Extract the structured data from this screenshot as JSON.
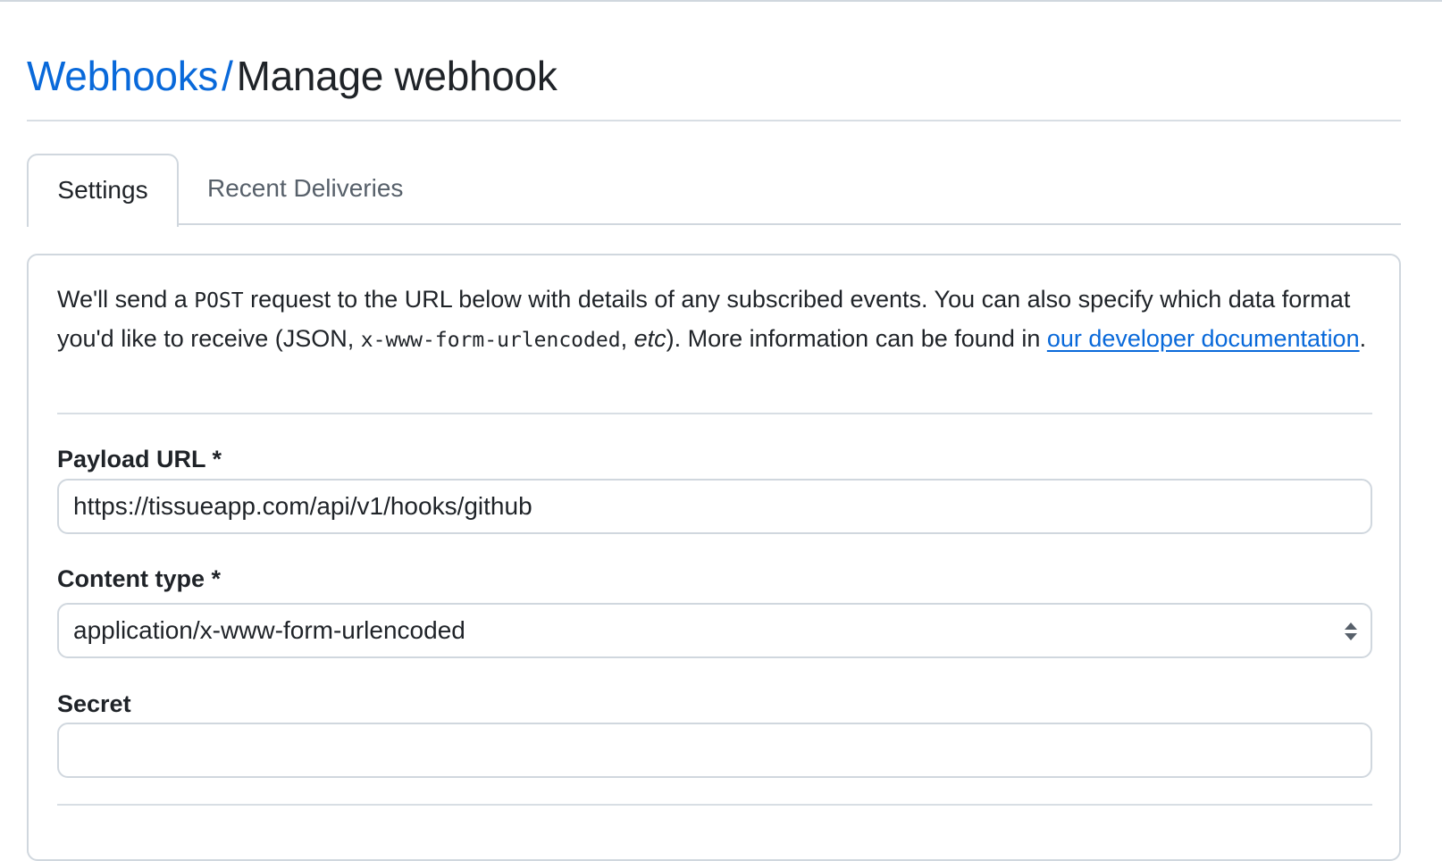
{
  "header": {
    "breadcrumb_parent": "Webhooks",
    "breadcrumb_separator": "/",
    "title": "Manage webhook"
  },
  "tabs": [
    {
      "label": "Settings",
      "selected": true
    },
    {
      "label": "Recent Deliveries",
      "selected": false
    }
  ],
  "intro": {
    "part1": "We'll send a ",
    "code1": "POST",
    "part2": " request to the URL below with details of any subscribed events. You can also specify which data format you'd like to receive (JSON, ",
    "code2": "x-www-form-urlencoded",
    "part3": ", ",
    "italic": "etc",
    "part4": "). More information can be found in ",
    "link": "our developer documentation",
    "part5": "."
  },
  "form": {
    "payload_url_label": "Payload URL *",
    "payload_url_value": "https://tissueapp.com/api/v1/hooks/github",
    "content_type_label": "Content type *",
    "content_type_value": "application/x-www-form-urlencoded",
    "secret_label": "Secret",
    "secret_value": ""
  },
  "colors": {
    "link": "#0969da",
    "border": "#d0d7de",
    "text": "#1f2328",
    "muted": "#57606a"
  },
  "icons": {
    "select_arrow": "updown-icon"
  }
}
